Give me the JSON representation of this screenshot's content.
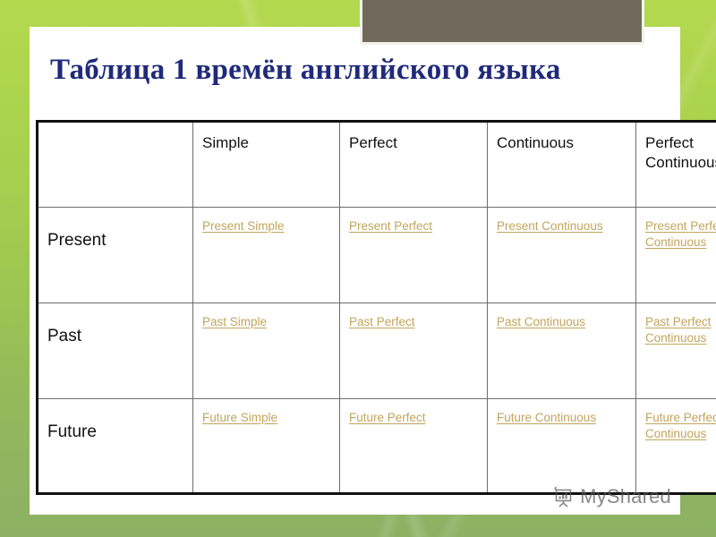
{
  "slide": {
    "background_top_color": "#b3d94f",
    "background_bottom_color": "#8cb163",
    "top_plate_color": "#716a5c"
  },
  "title": {
    "text": "Таблица 1 времён английского языка",
    "color": "#1f2a7a"
  },
  "table": {
    "link_color": "#c2a45c",
    "border_color": "#111111",
    "column_headers": [
      "",
      "Simple",
      "Perfect",
      "Continuous",
      "Perfect Continuous"
    ],
    "rows": [
      {
        "label": "Present",
        "cells": [
          "Present Simple",
          "Present Perfect",
          "Present Continuous",
          "Present Perfect Continuous"
        ]
      },
      {
        "label": "Past",
        "cells": [
          "Past Simple",
          "Past Perfect",
          "Past Continuous",
          "Past Perfect Continuous"
        ]
      },
      {
        "label": "Future",
        "cells": [
          "Future Simple",
          "Future Perfect",
          "Future Continuous",
          "Future Perfect Continuous"
        ]
      }
    ]
  },
  "watermark": {
    "text": "MyShared",
    "icon": "presentation-board-icon"
  }
}
